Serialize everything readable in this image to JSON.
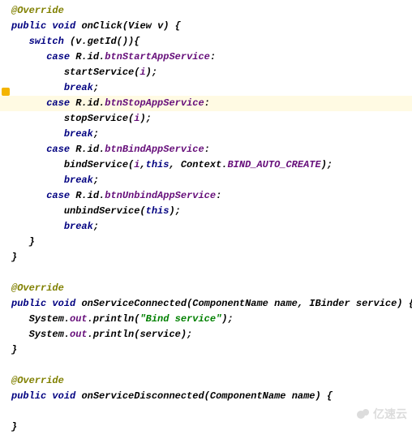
{
  "ann": {
    "override": "@Override"
  },
  "kw": {
    "public": "public",
    "void": "void",
    "switch": "switch",
    "case": "case",
    "break": "break",
    "this": "this"
  },
  "m1": {
    "sig_name": "onClick",
    "sig_params": "(View v) {",
    "switch_open": " (v.getId()){",
    "c1": {
      "pre": " R.id.",
      "id": "btnStartAppService",
      "post": ":",
      "body1_a": "startService(",
      "body1_b": "i",
      "body1_c": ");"
    },
    "c2": {
      "pre": " R.id.",
      "id": "btnStopAppService",
      "post": ":",
      "body1_a": "stopService(",
      "body1_b": "i",
      "body1_c": ");"
    },
    "c3": {
      "pre": " R.id.",
      "id": "btnBindAppService",
      "post": ":",
      "body1_a": "bindService(",
      "body1_b": "i",
      "body1_c": ",",
      "body1_d": ", Context.",
      "body1_e": "BIND_AUTO_CREATE",
      "body1_f": ");"
    },
    "c4": {
      "pre": " R.id.",
      "id": "btnUnbindAppService",
      "post": ":",
      "body1_a": "unbindService(",
      "body1_c": ");"
    },
    "semi": ";",
    "brace_close": "}"
  },
  "m2": {
    "sig_name": "onServiceConnected",
    "sig_params": "(ComponentName name, IBinder service) {",
    "l1_a": "System.",
    "out": "out",
    "l1_b": ".println(",
    "l1_c": "\"Bind service\"",
    "l1_d": ");",
    "l2_a": "System.",
    "l2_b": ".println(service);",
    "brace_close": "}"
  },
  "m3": {
    "sig_name": "onServiceDisconnected",
    "sig_params": "(ComponentName name) {",
    "brace_close": "}"
  },
  "watermark": "亿速云"
}
